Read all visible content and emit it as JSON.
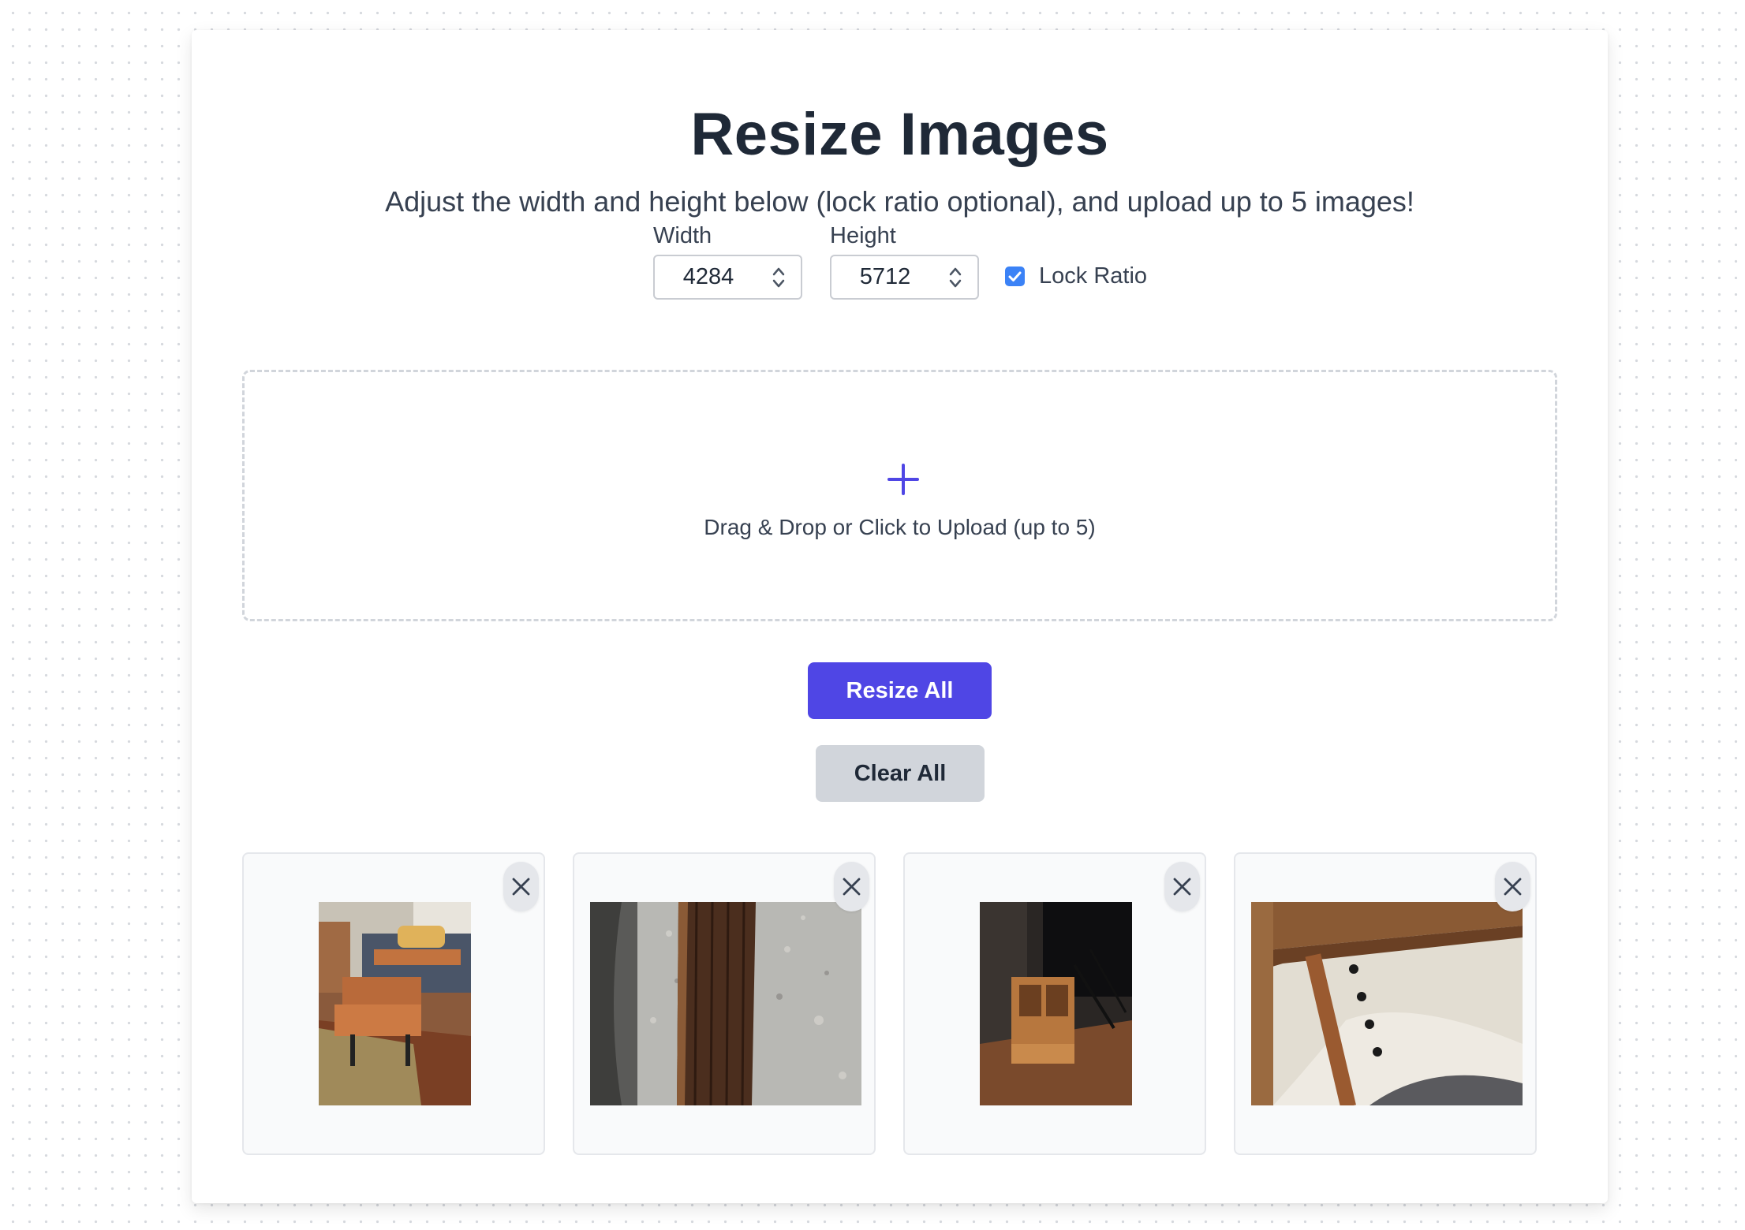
{
  "page": {
    "title": "Resize Images",
    "subtitle": "Adjust the width and height below (lock ratio optional), and upload up to 5 images!"
  },
  "dimensions": {
    "width_label": "Width",
    "width_value": "4284",
    "height_label": "Height",
    "height_value": "5712",
    "lock_ratio_label": "Lock Ratio",
    "lock_ratio_checked": true
  },
  "dropzone": {
    "text": "Drag & Drop or Click to Upload (up to 5)",
    "icon": "plus-icon"
  },
  "actions": {
    "resize_label": "Resize All",
    "clear_label": "Clear All"
  },
  "images": [
    {
      "subject": "coffee table in living room",
      "remove_icon": "close-icon"
    },
    {
      "subject": "wooden cutting board on granite counter",
      "remove_icon": "close-icon"
    },
    {
      "subject": "wooden box on floor",
      "remove_icon": "close-icon"
    },
    {
      "subject": "wooden coat hook rack",
      "remove_icon": "close-icon"
    }
  ],
  "colors": {
    "accent": "#4f46e5",
    "checkbox": "#3b82f6",
    "secondary_button": "#d1d5db",
    "text_dark": "#1f2937"
  }
}
